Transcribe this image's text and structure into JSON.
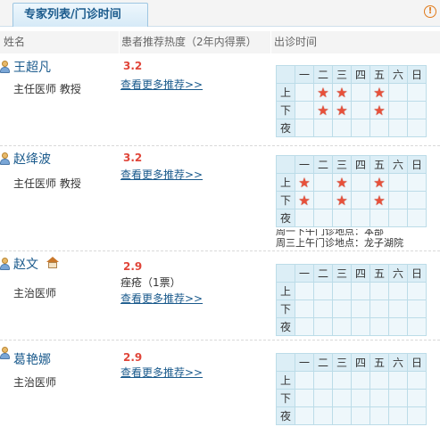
{
  "header": {
    "tab_label": "专家列表/门诊时间",
    "warn_icon": "!"
  },
  "columns": {
    "name": "姓名",
    "popularity": "患者推荐热度（2年内得票）",
    "schedule": "出诊时间"
  },
  "schedule_labels": {
    "days": [
      "一",
      "二",
      "三",
      "四",
      "五",
      "六",
      "日"
    ],
    "periods": [
      "上",
      "下",
      "夜"
    ]
  },
  "icons": {
    "person": "person-icon",
    "home": "home-icon",
    "star": "★",
    "star_color": "#e8503a"
  },
  "doctors": [
    {
      "name": "王超凡",
      "title": "主任医师  教授",
      "score": "3.2",
      "votes": "",
      "more_link": "查看更多推荐>>",
      "schedule": [
        [
          false,
          true,
          true,
          false,
          true,
          false,
          false
        ],
        [
          false,
          true,
          true,
          false,
          true,
          false,
          false
        ],
        [
          false,
          false,
          false,
          false,
          false,
          false,
          false
        ]
      ]
    },
    {
      "name": "赵绛波",
      "title": "主任医师  教授",
      "score": "3.2",
      "votes": "",
      "more_link": "查看更多推荐>>",
      "schedule": [
        [
          true,
          false,
          true,
          false,
          true,
          false,
          false
        ],
        [
          true,
          false,
          true,
          false,
          true,
          false,
          false
        ],
        [
          false,
          false,
          false,
          false,
          false,
          false,
          false
        ]
      ],
      "notes": [
        "周一下午门诊地点：本部",
        "周三上午门诊地点：龙子湖院"
      ]
    },
    {
      "name": "赵文",
      "title": "主治医师",
      "score": "2.9",
      "votes": "痤疮（1票）",
      "more_link": "查看更多推荐>>",
      "schedule": [
        [
          false,
          false,
          false,
          false,
          false,
          false,
          false
        ],
        [
          false,
          false,
          false,
          false,
          false,
          false,
          false
        ],
        [
          false,
          false,
          false,
          false,
          false,
          false,
          false
        ]
      ]
    },
    {
      "name": "葛艳娜",
      "title": "主治医师",
      "score": "2.9",
      "votes": "",
      "more_link": "查看更多推荐>>",
      "schedule": [
        [
          false,
          false,
          false,
          false,
          false,
          false,
          false
        ],
        [
          false,
          false,
          false,
          false,
          false,
          false,
          false
        ],
        [
          false,
          false,
          false,
          false,
          false,
          false,
          false
        ]
      ]
    }
  ]
}
